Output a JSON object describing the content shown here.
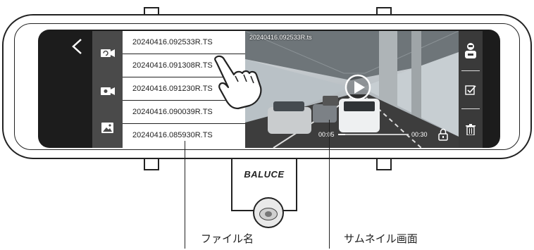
{
  "device": {
    "brand": "BALUCE"
  },
  "screen": {
    "back_icon": "back-arrow-icon",
    "side_icons": [
      "rotating-camera-icon",
      "video-camera-icon",
      "photo-icon"
    ],
    "files": [
      "20240416.092533R.TS",
      "20240416.091308R.TS",
      "20240416.091230R.TS",
      "20240416.090039R.TS",
      "20240416.085930R.TS"
    ],
    "thumbnail": {
      "title": "20240416.092533R.ts",
      "time_start": "00:05",
      "time_end": "00:30",
      "progress": 0.1
    },
    "right_icons": [
      "driver-icon",
      "checkbox-icon",
      "trash-icon"
    ]
  },
  "callouts": {
    "filename": "ファイル名",
    "thumbnail": "サムネイル画面"
  }
}
